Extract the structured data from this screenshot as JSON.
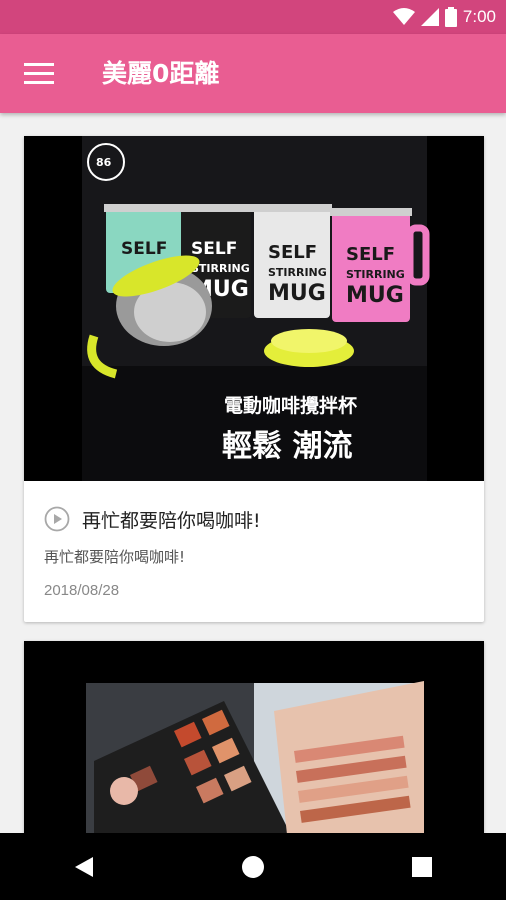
{
  "status_bar": {
    "time": "7:00"
  },
  "app_bar": {
    "title": "美麗0距離"
  },
  "posts": [
    {
      "thumbnail": {
        "badge": "86",
        "mug_labels": [
          "SELF",
          "STIRRING",
          "MUG"
        ],
        "caption_line1": "電動咖啡攪拌杯",
        "caption_line2": "輕鬆 潮流"
      },
      "title": "再忙都要陪你喝咖啡!",
      "subtitle": "再忙都要陪你喝咖啡!",
      "date": "2018/08/28"
    },
    {
      "thumbnail": {
        "description_icon": "eyeshadow-palette"
      }
    }
  ],
  "colors": {
    "status_bar": "#d2457d",
    "app_bar": "#e95d92",
    "nav_bar": "#000000"
  }
}
